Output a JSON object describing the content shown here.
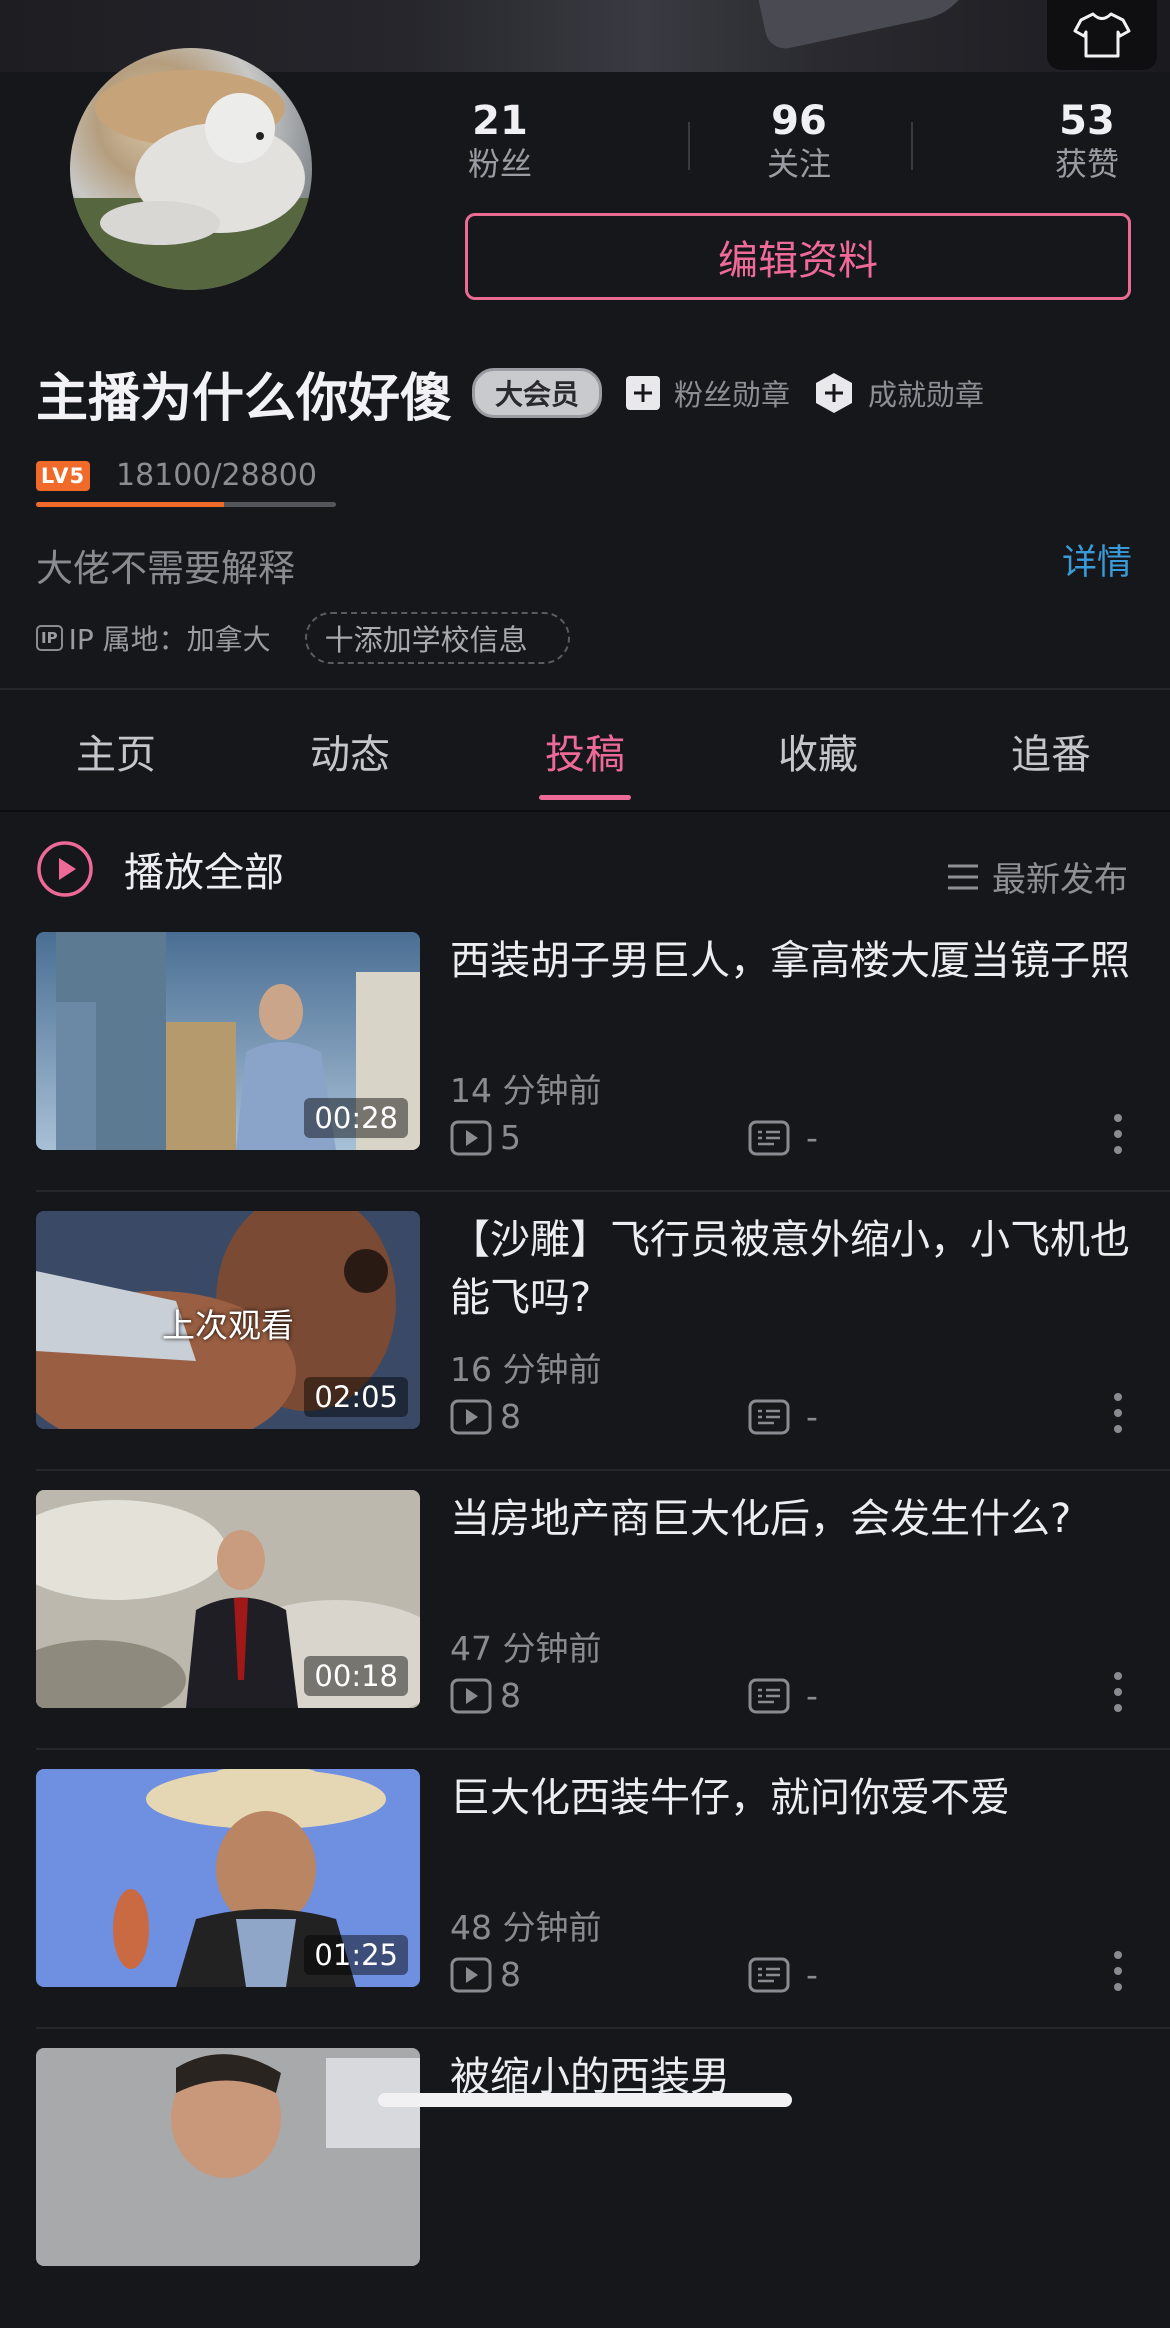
{
  "profile": {
    "stats": [
      {
        "value": "21",
        "label": "粉丝"
      },
      {
        "value": "96",
        "label": "关注"
      },
      {
        "value": "53",
        "label": "获赞"
      }
    ],
    "edit_button": "编辑资料",
    "name": "主播为什么你好傻",
    "vip_badge": "大会员",
    "fan_medal": "粉丝勋章",
    "achievement_medal": "成就勋章",
    "level_badge": "LV5",
    "experience": "18100/28800",
    "experience_fraction": 0.628,
    "bio": "大佬不需要解释",
    "detail_link": "详情",
    "ip_tag": "IP",
    "ip_location": "IP 属地：加拿大",
    "add_school": "十添加学校信息"
  },
  "tabs": [
    "主页",
    "动态",
    "投稿",
    "收藏",
    "追番"
  ],
  "active_tab": "投稿",
  "list_header": {
    "play_all": "播放全部",
    "sort": "最新发布"
  },
  "videos": [
    {
      "title": "西装胡子男巨人，拿高楼大厦当镜子照",
      "time": "14 分钟前",
      "plays": "5",
      "danmaku": "-",
      "duration": "00:28",
      "overlay": ""
    },
    {
      "title": "【沙雕】飞行员被意外缩小，小飞机也能飞吗?",
      "time": "16 分钟前",
      "plays": "8",
      "danmaku": "-",
      "duration": "02:05",
      "overlay": "上次观看"
    },
    {
      "title": "当房地产商巨大化后，会发生什么?",
      "time": "47 分钟前",
      "plays": "8",
      "danmaku": "-",
      "duration": "00:18",
      "overlay": ""
    },
    {
      "title": "巨大化西装牛仔，就问你爱不爱",
      "time": "48 分钟前",
      "plays": "8",
      "danmaku": "-",
      "duration": "01:25",
      "overlay": ""
    },
    {
      "title": "被缩小的西装男",
      "time": "",
      "plays": "",
      "danmaku": "",
      "duration": "",
      "overlay": ""
    }
  ],
  "colors": {
    "accent": "#ee6a96",
    "link": "#3a9bd9",
    "level": "#f06b2a",
    "background": "#16171b"
  }
}
